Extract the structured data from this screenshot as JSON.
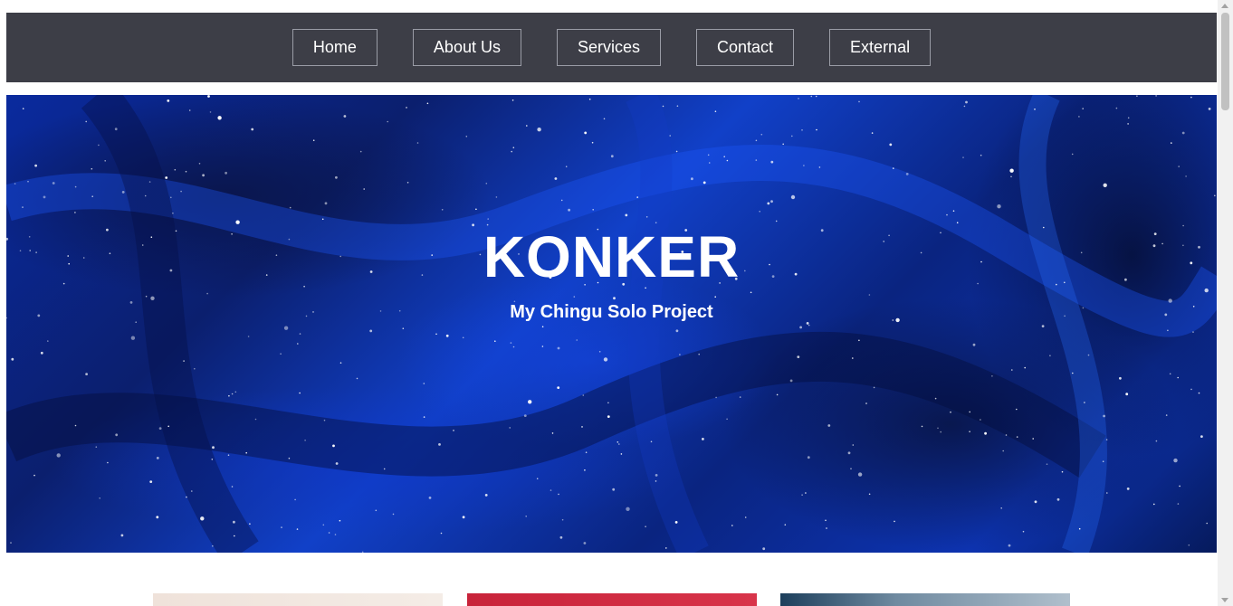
{
  "nav": {
    "items": [
      {
        "label": "Home"
      },
      {
        "label": "About Us"
      },
      {
        "label": "Services"
      },
      {
        "label": "Contact"
      },
      {
        "label": "External"
      }
    ]
  },
  "hero": {
    "title": "KONKER",
    "subtitle": "My Chingu Solo Project"
  },
  "colors": {
    "navbar_bg": "#3d3e47",
    "nav_border": "#9a9ca6",
    "hero_accent": "#1140c8",
    "text": "#ffffff"
  },
  "icons": {
    "scroll_up": "chevron-up-icon",
    "scroll_down": "chevron-down-icon"
  }
}
